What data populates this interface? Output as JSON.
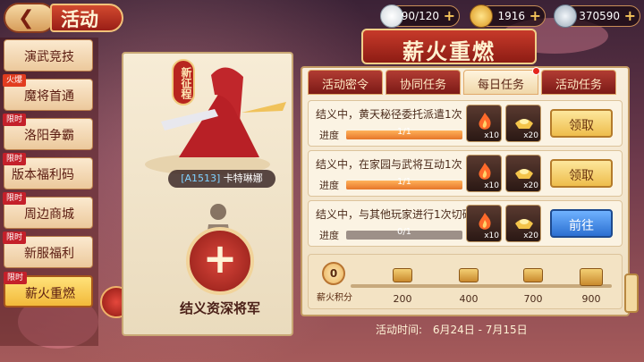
{
  "header": {
    "back_icon": "back-arrow-icon",
    "title": "活动",
    "resources": [
      {
        "icon": "rice-bowl-icon",
        "value": "90/120"
      },
      {
        "icon": "gold-ingot-icon",
        "value": "1916"
      },
      {
        "icon": "silver-coin-icon",
        "value": "370590"
      }
    ],
    "plus": "+"
  },
  "sidebar": {
    "items": [
      {
        "label": "演武竞技",
        "tag": ""
      },
      {
        "label": "魔将首通",
        "tag": "火爆"
      },
      {
        "label": "洛阳争霸",
        "tag": "限时"
      },
      {
        "label": "版本福利码",
        "tag": "限时"
      },
      {
        "label": "周边商城",
        "tag": "限时"
      },
      {
        "label": "新服福利",
        "tag": "限时"
      },
      {
        "label": "薪火重燃",
        "tag": "限时"
      }
    ],
    "active_index": 6
  },
  "hero": {
    "badge": "新征程",
    "code": "[A1513]",
    "name": "卡特琳娜",
    "add_symbol": "+",
    "recruit_label": "结义资深将军"
  },
  "main": {
    "title": "薪火重燃",
    "tabs": [
      {
        "label": "活动密令"
      },
      {
        "label": "协同任务"
      },
      {
        "label": "每日任务"
      },
      {
        "label": "活动任务"
      }
    ],
    "active_tab": 2,
    "tasks": [
      {
        "desc": "结义中，黄天秘径委托派遣1次",
        "progress_label": "进度",
        "progress_text": "1/1",
        "progress": 1.0,
        "rewards": [
          {
            "icon": "fire-icon",
            "count": "x10"
          },
          {
            "icon": "gold-ingot-icon",
            "count": "x20"
          }
        ],
        "button": "领取",
        "button_type": "claim"
      },
      {
        "desc": "结义中，在家园与武将互动1次",
        "progress_label": "进度",
        "progress_text": "1/1",
        "progress": 1.0,
        "rewards": [
          {
            "icon": "fire-icon",
            "count": "x10"
          },
          {
            "icon": "gold-ingot-icon",
            "count": "x20"
          }
        ],
        "button": "领取",
        "button_type": "claim"
      },
      {
        "desc": "结义中，与其他玩家进行1次切磋",
        "progress_label": "进度",
        "progress_text": "0/1",
        "progress": 0.0,
        "rewards": [
          {
            "icon": "fire-icon",
            "count": "x10"
          },
          {
            "icon": "gold-ingot-icon",
            "count": "x20"
          }
        ],
        "button": "前往",
        "button_type": "go"
      }
    ],
    "score": {
      "value": "0",
      "label": "薪火积分",
      "milestones": [
        "200",
        "400",
        "700",
        "900"
      ]
    },
    "time_label": "活动时间:",
    "time_range": "6月24日 - 7月15日"
  },
  "colors": {
    "accent_red": "#b8261f",
    "gold": "#f2b93a",
    "go_blue": "#2b6fd1"
  }
}
